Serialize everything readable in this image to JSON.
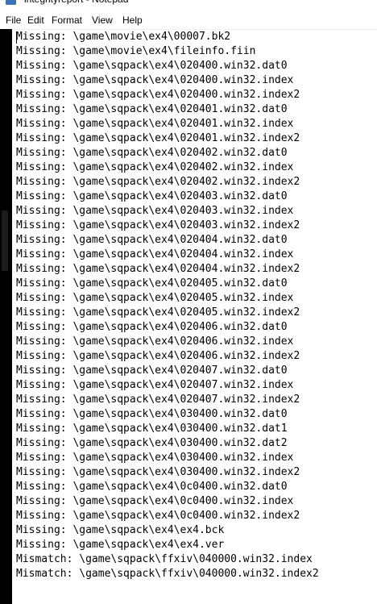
{
  "window": {
    "title": "integrityreport - Notepad"
  },
  "menu": {
    "items": [
      "File",
      "Edit",
      "Format",
      "View",
      "Help"
    ]
  },
  "editor": {
    "lines": [
      "Missing: \\game\\movie\\ex4\\00007.bk2",
      "Missing: \\game\\movie\\ex4\\fileinfo.fiin",
      "Missing: \\game\\sqpack\\ex4\\020400.win32.dat0",
      "Missing: \\game\\sqpack\\ex4\\020400.win32.index",
      "Missing: \\game\\sqpack\\ex4\\020400.win32.index2",
      "Missing: \\game\\sqpack\\ex4\\020401.win32.dat0",
      "Missing: \\game\\sqpack\\ex4\\020401.win32.index",
      "Missing: \\game\\sqpack\\ex4\\020401.win32.index2",
      "Missing: \\game\\sqpack\\ex4\\020402.win32.dat0",
      "Missing: \\game\\sqpack\\ex4\\020402.win32.index",
      "Missing: \\game\\sqpack\\ex4\\020402.win32.index2",
      "Missing: \\game\\sqpack\\ex4\\020403.win32.dat0",
      "Missing: \\game\\sqpack\\ex4\\020403.win32.index",
      "Missing: \\game\\sqpack\\ex4\\020403.win32.index2",
      "Missing: \\game\\sqpack\\ex4\\020404.win32.dat0",
      "Missing: \\game\\sqpack\\ex4\\020404.win32.index",
      "Missing: \\game\\sqpack\\ex4\\020404.win32.index2",
      "Missing: \\game\\sqpack\\ex4\\020405.win32.dat0",
      "Missing: \\game\\sqpack\\ex4\\020405.win32.index",
      "Missing: \\game\\sqpack\\ex4\\020405.win32.index2",
      "Missing: \\game\\sqpack\\ex4\\020406.win32.dat0",
      "Missing: \\game\\sqpack\\ex4\\020406.win32.index",
      "Missing: \\game\\sqpack\\ex4\\020406.win32.index2",
      "Missing: \\game\\sqpack\\ex4\\020407.win32.dat0",
      "Missing: \\game\\sqpack\\ex4\\020407.win32.index",
      "Missing: \\game\\sqpack\\ex4\\020407.win32.index2",
      "Missing: \\game\\sqpack\\ex4\\030400.win32.dat0",
      "Missing: \\game\\sqpack\\ex4\\030400.win32.dat1",
      "Missing: \\game\\sqpack\\ex4\\030400.win32.dat2",
      "Missing: \\game\\sqpack\\ex4\\030400.win32.index",
      "Missing: \\game\\sqpack\\ex4\\030400.win32.index2",
      "Missing: \\game\\sqpack\\ex4\\0c0400.win32.dat0",
      "Missing: \\game\\sqpack\\ex4\\0c0400.win32.index",
      "Missing: \\game\\sqpack\\ex4\\0c0400.win32.index2",
      "Missing: \\game\\sqpack\\ex4\\ex4.bck",
      "Missing: \\game\\sqpack\\ex4\\ex4.ver",
      "Mismatch: \\game\\sqpack\\ffxiv\\040000.win32.index",
      "Mismatch: \\game\\sqpack\\ffxiv\\040000.win32.index2"
    ]
  }
}
